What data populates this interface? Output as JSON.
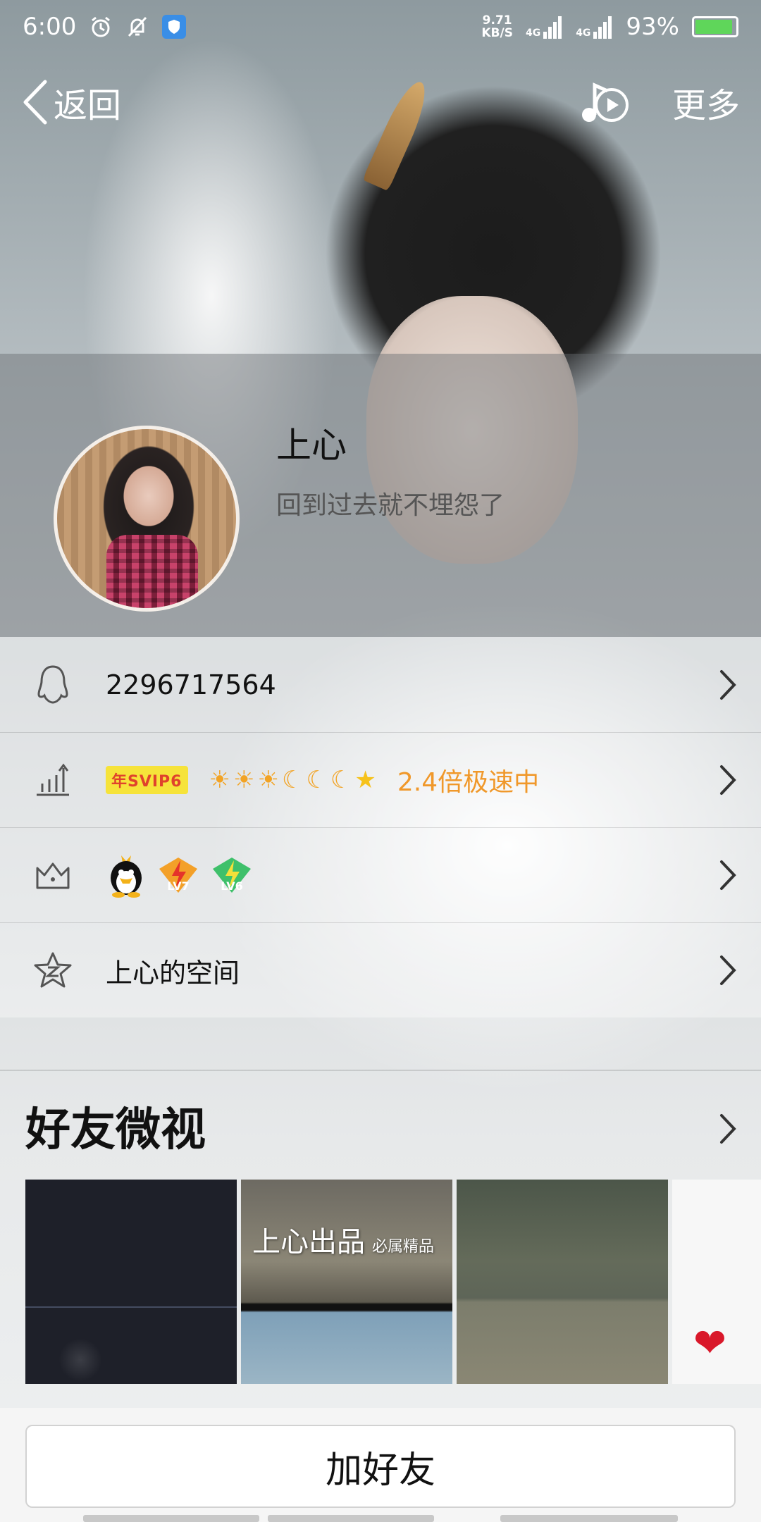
{
  "status_bar": {
    "time": "6:00",
    "net_speed_value": "9.71",
    "net_speed_unit": "KB/S",
    "signal_1": "4G",
    "signal_2": "4G",
    "battery_percent": "93%",
    "battery_level": 0.93
  },
  "nav": {
    "back_label": "返回",
    "more_label": "更多"
  },
  "profile": {
    "nickname": "上心",
    "signature": "回到过去就不埋怨了"
  },
  "info_rows": {
    "qq_number": "2296717564",
    "svip_badge": "年SVIP6",
    "speed_text": "2.4倍极速中",
    "vip_level_1": "LV7",
    "vip_level_2": "LV6",
    "space_label": "上心的空间"
  },
  "moments": {
    "title": "好友微视",
    "thumb_2_caption": "上心出品",
    "thumb_2_sub": "必属精品"
  },
  "bottom": {
    "add_friend_label": "加好友"
  },
  "colors": {
    "accent_orange": "#f0982a",
    "svip_yellow": "#f6e33a",
    "svip_red": "#e0422c",
    "battery_green": "#5fd65a"
  }
}
